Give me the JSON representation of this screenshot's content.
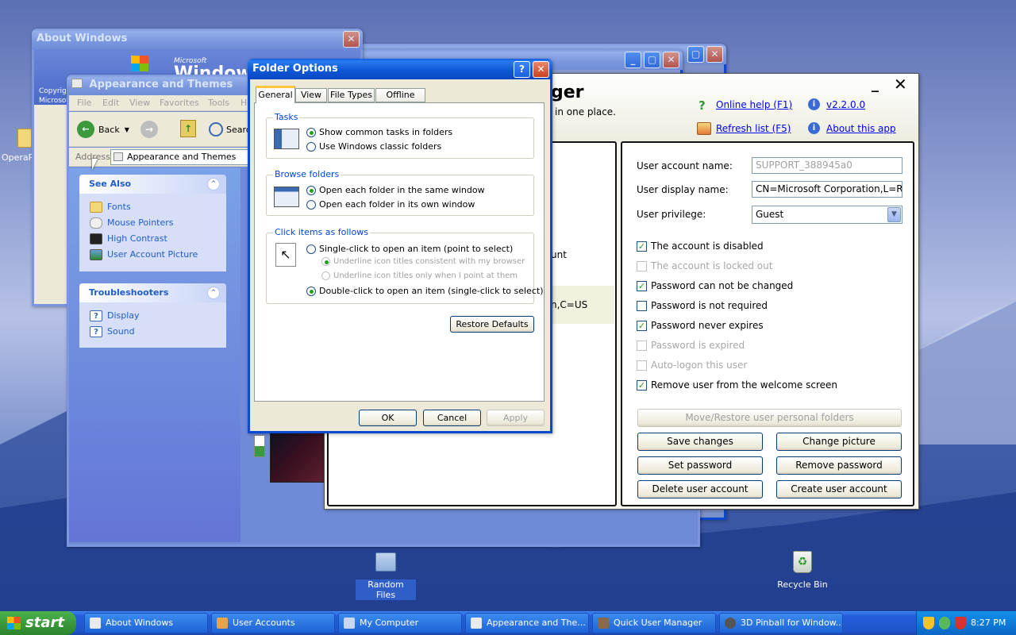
{
  "desktop": {
    "icons": [
      {
        "label": "OperaP"
      },
      {
        "label": "Random Files"
      },
      {
        "label": "Recycle Bin"
      }
    ]
  },
  "about_windows": {
    "title": "About Windows",
    "copyright1": "Copyrigh",
    "copyright2": "Microsof",
    "logo_small": "Microsoft",
    "logo_big": "Windows"
  },
  "appearance": {
    "title": "Appearance and Themes",
    "menu": [
      "File",
      "Edit",
      "View",
      "Favorites",
      "Tools",
      "He"
    ],
    "back": "Back",
    "search": "Searc",
    "address_label": "Address",
    "address_value": "Appearance and Themes",
    "see_also": {
      "title": "See Also",
      "items": [
        "Fonts",
        "Mouse Pointers",
        "High Contrast",
        "User Account Picture"
      ]
    },
    "troubleshooters": {
      "title": "Troubleshooters",
      "items": [
        "Display",
        "Sound"
      ]
    }
  },
  "folder_options": {
    "title": "Folder Options",
    "tabs": [
      "General",
      "View",
      "File Types",
      "Offline Files"
    ],
    "tasks": {
      "title": "Tasks",
      "opt1": "Show common tasks in folders",
      "opt2": "Use Windows classic folders"
    },
    "browse": {
      "title": "Browse folders",
      "opt1": "Open each folder in the same window",
      "opt2": "Open each folder in its own window"
    },
    "click": {
      "title": "Click items as follows",
      "opt1": "Single-click to open an item (point to select)",
      "sub1": "Underline icon titles consistent with my browser",
      "sub2": "Underline icon titles only when I point at them",
      "opt2": "Double-click to open an item (single-click to select)"
    },
    "restore": "Restore Defaults",
    "ok": "OK",
    "cancel": "Cancel",
    "apply": "Apply"
  },
  "qum": {
    "title_partial": "ger",
    "subtitle_partial": "in one place.",
    "online_help": "Online help (F1)",
    "version": "v2.2.0.0",
    "refresh": "Refresh list (F5)",
    "about": "About this app",
    "left_text1": "unt",
    "left_text2": "n,C=US",
    "fields": {
      "account_name_label": "User account name:",
      "account_name": "SUPPORT_388945a0",
      "display_name_label": "User display name:",
      "display_name": "CN=Microsoft Corporation,L=Re",
      "privilege_label": "User privilege:",
      "privilege": "Guest"
    },
    "checks": [
      {
        "label": "The account is disabled",
        "checked": "yes"
      },
      {
        "label": "The account is locked out",
        "checked": "no"
      },
      {
        "label": "Password can not be changed",
        "checked": "yes"
      },
      {
        "label": "Password is not required",
        "checked": "no"
      },
      {
        "label": "Password never expires",
        "checked": "yes"
      },
      {
        "label": "Password is expired",
        "checked": "no"
      },
      {
        "label": "Auto-logon this user",
        "checked": "no"
      },
      {
        "label": "Remove user from the welcome screen",
        "checked": "yes"
      }
    ],
    "buttons": {
      "move": "Move/Restore user personal folders",
      "save": "Save changes",
      "picture": "Change picture",
      "setpw": "Set password",
      "removepw": "Remove password",
      "delete": "Delete user account",
      "create": "Create user account"
    }
  },
  "taskbar": {
    "start": "start",
    "tasks": [
      "About Windows",
      "User Accounts",
      "My Computer",
      "Appearance and The...",
      "Quick User Manager",
      "3D Pinball for Window..."
    ],
    "clock": "8:27 PM"
  },
  "colors": {
    "xp_blue": "#0a4ad0",
    "taskbar": "#245edb",
    "start_green": "#3c9a3c"
  }
}
